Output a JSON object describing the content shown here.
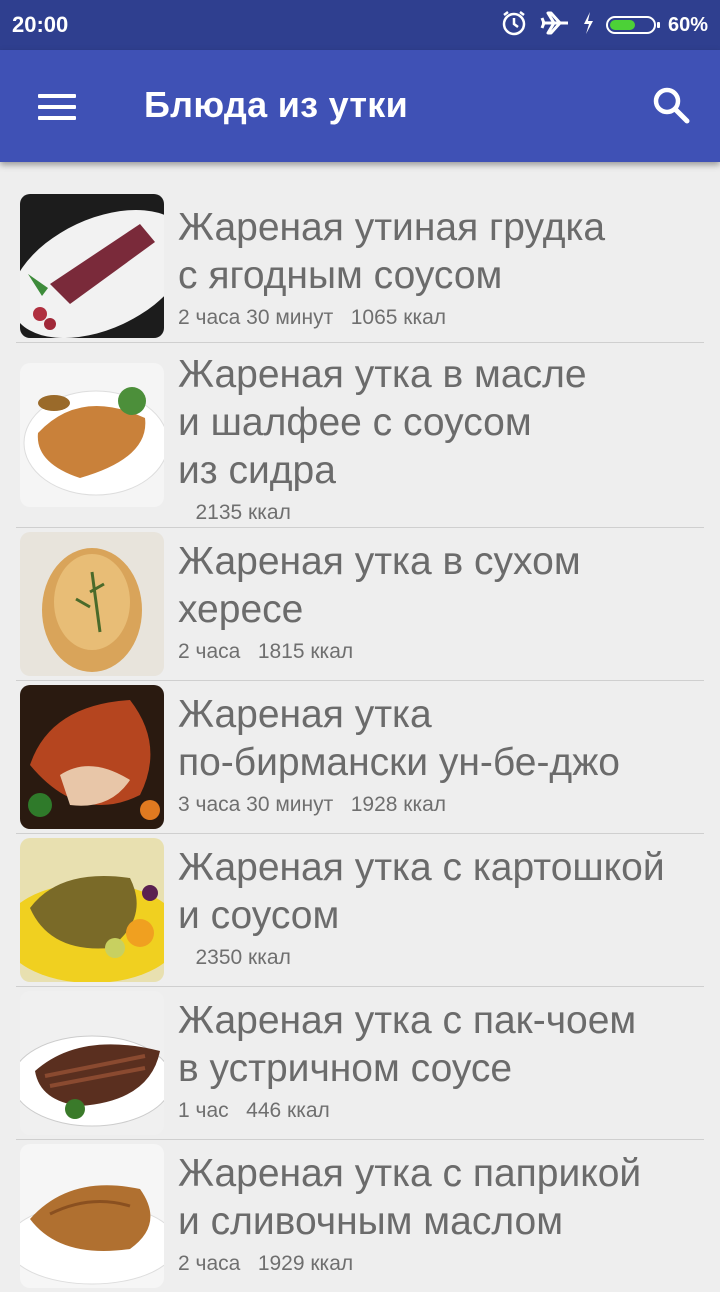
{
  "status_bar": {
    "time": "20:00",
    "battery_percent": "60%",
    "battery_level": 0.6,
    "icons": [
      "alarm-icon",
      "airplane-icon",
      "charging-icon",
      "battery-icon"
    ]
  },
  "app_bar": {
    "title": "Блюда из утки",
    "menu_icon": "hamburger-menu-icon",
    "search_icon": "search-icon",
    "color": "#3f51b5"
  },
  "recipes": [
    {
      "name": "Жареная утиная грудка\nс ягодным соусом",
      "meta": "2 часа 30 минут   1065 ккал"
    },
    {
      "name": "Жареная утка в масле\nи шалфее с соусом\nиз сидра",
      "meta": "   2135 ккал"
    },
    {
      "name": "Жареная утка в сухом\nхересе",
      "meta": "2 часа   1815 ккал"
    },
    {
      "name": "Жареная утка\nпо-бирмански ун-бе-джо",
      "meta": "3 часа 30 минут   1928 ккал"
    },
    {
      "name": "Жареная утка с картошкой\nи соусом",
      "meta": "   2350 ккал"
    },
    {
      "name": "Жареная утка с пак-чоем\nв устричном соусе",
      "meta": "1 час   446 ккал"
    },
    {
      "name": "Жареная утка с паприкой\nи сливочным маслом",
      "meta": "2 часа   1929 ккал"
    }
  ]
}
